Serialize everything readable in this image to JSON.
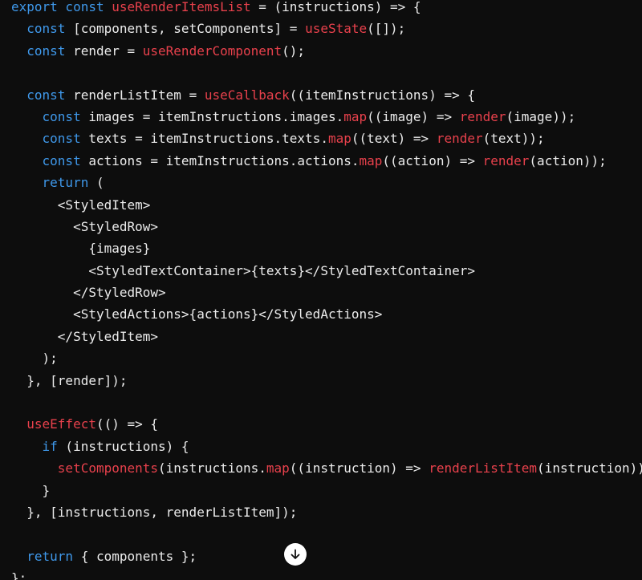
{
  "colors": {
    "background": "#0d0d0d",
    "plain": "#ececec",
    "keyword": "#3f98ea",
    "function": "#e8414c",
    "scroll_button": "#ffffff"
  },
  "scroll_button": {
    "icon": "arrow-down-icon"
  },
  "code_lines": [
    [
      {
        "t": "export const ",
        "c": "kw"
      },
      {
        "t": "useRenderItemsList",
        "c": "fn"
      },
      {
        "t": " = (instructions) => {",
        "c": "pl"
      }
    ],
    [
      {
        "t": "  ",
        "c": "pl"
      },
      {
        "t": "const",
        "c": "kw"
      },
      {
        "t": " [components, setComponents] = ",
        "c": "pl"
      },
      {
        "t": "useState",
        "c": "fn"
      },
      {
        "t": "([]);",
        "c": "pl"
      }
    ],
    [
      {
        "t": "  ",
        "c": "pl"
      },
      {
        "t": "const",
        "c": "kw"
      },
      {
        "t": " render = ",
        "c": "pl"
      },
      {
        "t": "useRenderComponent",
        "c": "fn"
      },
      {
        "t": "();",
        "c": "pl"
      }
    ],
    [],
    [
      {
        "t": "  ",
        "c": "pl"
      },
      {
        "t": "const",
        "c": "kw"
      },
      {
        "t": " renderListItem = ",
        "c": "pl"
      },
      {
        "t": "useCallback",
        "c": "fn"
      },
      {
        "t": "((itemInstructions) => {",
        "c": "pl"
      }
    ],
    [
      {
        "t": "    ",
        "c": "pl"
      },
      {
        "t": "const",
        "c": "kw"
      },
      {
        "t": " images = itemInstructions.images.",
        "c": "pl"
      },
      {
        "t": "map",
        "c": "fn"
      },
      {
        "t": "((image) => ",
        "c": "pl"
      },
      {
        "t": "render",
        "c": "fn"
      },
      {
        "t": "(image));",
        "c": "pl"
      }
    ],
    [
      {
        "t": "    ",
        "c": "pl"
      },
      {
        "t": "const",
        "c": "kw"
      },
      {
        "t": " texts = itemInstructions.texts.",
        "c": "pl"
      },
      {
        "t": "map",
        "c": "fn"
      },
      {
        "t": "((text) => ",
        "c": "pl"
      },
      {
        "t": "render",
        "c": "fn"
      },
      {
        "t": "(text));",
        "c": "pl"
      }
    ],
    [
      {
        "t": "    ",
        "c": "pl"
      },
      {
        "t": "const",
        "c": "kw"
      },
      {
        "t": " actions = itemInstructions.actions.",
        "c": "pl"
      },
      {
        "t": "map",
        "c": "fn"
      },
      {
        "t": "((action) => ",
        "c": "pl"
      },
      {
        "t": "render",
        "c": "fn"
      },
      {
        "t": "(action));",
        "c": "pl"
      }
    ],
    [
      {
        "t": "    ",
        "c": "pl"
      },
      {
        "t": "return",
        "c": "kw"
      },
      {
        "t": " (",
        "c": "pl"
      }
    ],
    [
      {
        "t": "      <StyledItem>",
        "c": "pl"
      }
    ],
    [
      {
        "t": "        <StyledRow>",
        "c": "pl"
      }
    ],
    [
      {
        "t": "          {images}",
        "c": "pl"
      }
    ],
    [
      {
        "t": "          <StyledTextContainer>{texts}</StyledTextContainer>",
        "c": "pl"
      }
    ],
    [
      {
        "t": "        </StyledRow>",
        "c": "pl"
      }
    ],
    [
      {
        "t": "        <StyledActions>{actions}</StyledActions>",
        "c": "pl"
      }
    ],
    [
      {
        "t": "      </StyledItem>",
        "c": "pl"
      }
    ],
    [
      {
        "t": "    );",
        "c": "pl"
      }
    ],
    [
      {
        "t": "  }, [render]);",
        "c": "pl"
      }
    ],
    [],
    [
      {
        "t": "  ",
        "c": "pl"
      },
      {
        "t": "useEffect",
        "c": "fn"
      },
      {
        "t": "(() => {",
        "c": "pl"
      }
    ],
    [
      {
        "t": "    ",
        "c": "pl"
      },
      {
        "t": "if",
        "c": "kw"
      },
      {
        "t": " (instructions) {",
        "c": "pl"
      }
    ],
    [
      {
        "t": "      ",
        "c": "pl"
      },
      {
        "t": "setComponents",
        "c": "fn"
      },
      {
        "t": "(instructions.",
        "c": "pl"
      },
      {
        "t": "map",
        "c": "fn"
      },
      {
        "t": "((instruction) => ",
        "c": "pl"
      },
      {
        "t": "renderListItem",
        "c": "fn"
      },
      {
        "t": "(instruction))",
        "c": "pl"
      }
    ],
    [
      {
        "t": "    }",
        "c": "pl"
      }
    ],
    [
      {
        "t": "  }, [instructions, renderListItem]);",
        "c": "pl"
      }
    ],
    [],
    [
      {
        "t": "  ",
        "c": "pl"
      },
      {
        "t": "return",
        "c": "kw"
      },
      {
        "t": " { components };",
        "c": "pl"
      }
    ],
    [
      {
        "t": "};",
        "c": "pl"
      }
    ]
  ]
}
